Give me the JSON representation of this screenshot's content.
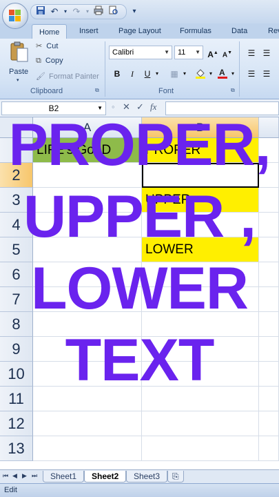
{
  "quick_access": {
    "more_icon": "▾"
  },
  "tabs": [
    "Home",
    "Insert",
    "Page Layout",
    "Formulas",
    "Data",
    "Revi"
  ],
  "ribbon": {
    "clipboard": {
      "paste_label": "Paste",
      "cut_label": "Cut",
      "copy_label": "Copy",
      "format_painter_label": "Format Painter",
      "group_label": "Clipboard"
    },
    "font": {
      "font_name": "Calibri",
      "font_size": "11",
      "group_label": "Font"
    }
  },
  "formula_bar": {
    "name_box": "B2",
    "fx_label": "fx",
    "formula": ""
  },
  "columns": [
    "A",
    "B"
  ],
  "rows": [
    "1",
    "2",
    "3",
    "4",
    "5",
    "6",
    "7",
    "8",
    "9",
    "10",
    "11",
    "12",
    "13"
  ],
  "cells": {
    "A1": "LIFE's GooD",
    "B1": "PROPER",
    "B3": "UPPER",
    "B5": "LOWER"
  },
  "sheets": [
    "Sheet1",
    "Sheet2",
    "Sheet3"
  ],
  "active_sheet": "Sheet2",
  "status": "Edit",
  "overlay": {
    "line1": "PROPER,",
    "line2": "UPPER ,",
    "line3": "LOWER",
    "line4": "TEXT",
    "color": "#6a23ee"
  },
  "colors": {
    "green_fill": "#8ebb4a",
    "yellow_fill": "#ffef00"
  }
}
